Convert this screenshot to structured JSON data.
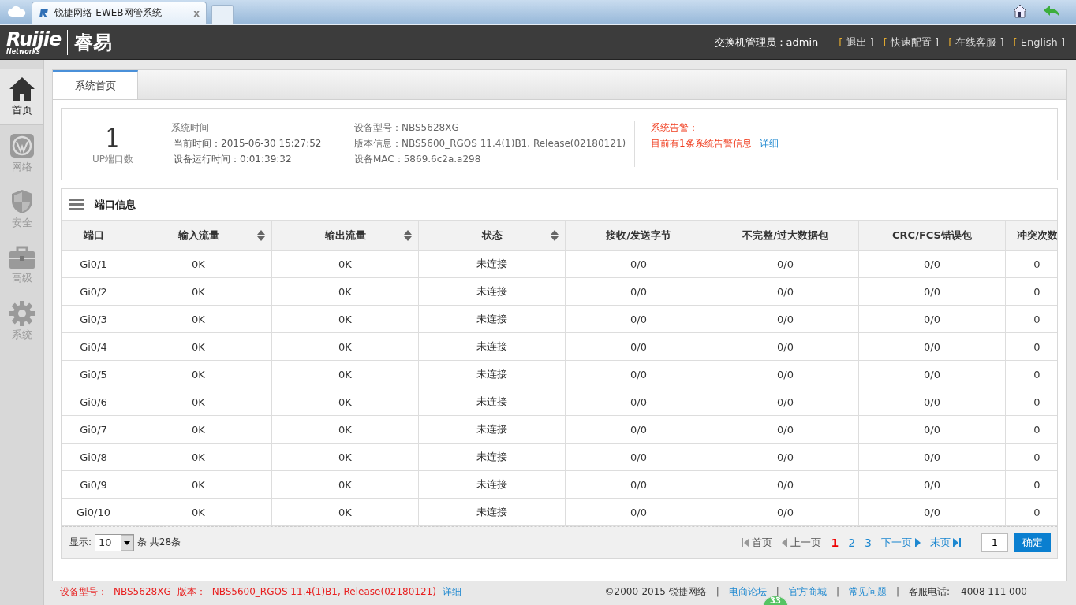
{
  "browser": {
    "tab_title": "锐捷网络-EWEB网管系统",
    "tab_close": "x"
  },
  "header": {
    "logo_text": "Ruijie",
    "logo_sub": "Networks",
    "product": "睿易",
    "admin_label": "交换机管理员：admin",
    "links": [
      {
        "open": "[",
        "label": "退出",
        "close": "]"
      },
      {
        "open": "[",
        "label": "快速配置",
        "close": "]"
      },
      {
        "open": "[",
        "label": "在线客服",
        "close": "]"
      },
      {
        "open": "[",
        "label": "English",
        "close": "]"
      }
    ]
  },
  "sidebar": {
    "items": [
      {
        "label": "首页",
        "kind": "home",
        "selected": true
      },
      {
        "label": "网络",
        "kind": "network",
        "selected": false
      },
      {
        "label": "安全",
        "kind": "security",
        "selected": false
      },
      {
        "label": "高级",
        "kind": "advanced",
        "selected": false
      },
      {
        "label": "系统",
        "kind": "system",
        "selected": false
      }
    ]
  },
  "tabs": [
    {
      "label": "系统首页",
      "selected": true
    }
  ],
  "summary": {
    "up_count": "1",
    "up_label": "UP端口数",
    "time_title": "系统时间",
    "current_time": "当前时间：2015-06-30 15:27:52",
    "uptime": "设备运行时间：0:01:39:32",
    "model": "设备型号：NBS5628XG",
    "version": "版本信息：NBS5600_RGOS 11.4(1)B1, Release(02180121)",
    "mac": "设备MAC：5869.6c2a.a298",
    "alarm_title": "系统告警：",
    "alarm_text": "目前有1条系统告警信息",
    "alarm_link": "详细"
  },
  "port_panel": {
    "title": "端口信息",
    "table": {
      "columns": [
        {
          "label": "端口",
          "sortable": false
        },
        {
          "label": "输入流量",
          "sortable": true
        },
        {
          "label": "输出流量",
          "sortable": true
        },
        {
          "label": "状态",
          "sortable": true
        },
        {
          "label": "接收/发送字节",
          "sortable": false
        },
        {
          "label": "不完整/过大数据包",
          "sortable": false
        },
        {
          "label": "CRC/FCS错误包",
          "sortable": false
        },
        {
          "label": "冲突次数",
          "sortable": false
        }
      ],
      "rows": [
        [
          "Gi0/1",
          "0K",
          "0K",
          "未连接",
          "0/0",
          "0/0",
          "0/0",
          "0"
        ],
        [
          "Gi0/2",
          "0K",
          "0K",
          "未连接",
          "0/0",
          "0/0",
          "0/0",
          "0"
        ],
        [
          "Gi0/3",
          "0K",
          "0K",
          "未连接",
          "0/0",
          "0/0",
          "0/0",
          "0"
        ],
        [
          "Gi0/4",
          "0K",
          "0K",
          "未连接",
          "0/0",
          "0/0",
          "0/0",
          "0"
        ],
        [
          "Gi0/5",
          "0K",
          "0K",
          "未连接",
          "0/0",
          "0/0",
          "0/0",
          "0"
        ],
        [
          "Gi0/6",
          "0K",
          "0K",
          "未连接",
          "0/0",
          "0/0",
          "0/0",
          "0"
        ],
        [
          "Gi0/7",
          "0K",
          "0K",
          "未连接",
          "0/0",
          "0/0",
          "0/0",
          "0"
        ],
        [
          "Gi0/8",
          "0K",
          "0K",
          "未连接",
          "0/0",
          "0/0",
          "0/0",
          "0"
        ],
        [
          "Gi0/9",
          "0K",
          "0K",
          "未连接",
          "0/0",
          "0/0",
          "0/0",
          "0"
        ],
        [
          "Gi0/10",
          "0K",
          "0K",
          "未连接",
          "0/0",
          "0/0",
          "0/0",
          "0"
        ]
      ]
    },
    "pager": {
      "show_label": "显示:",
      "page_size": "10",
      "total": "条 共28条",
      "first": {
        "label": "首页",
        "disabled": true
      },
      "prev": {
        "label": "上一页",
        "disabled": true
      },
      "pages": [
        {
          "label": "1",
          "selected": true
        },
        {
          "label": "2",
          "selected": false
        },
        {
          "label": "3",
          "selected": false
        }
      ],
      "next": {
        "label": "下一页",
        "disabled": false
      },
      "last": {
        "label": "末页",
        "disabled": false
      },
      "goto_value": "1",
      "confirm": "确定"
    }
  },
  "footer": {
    "model_label": "设备型号：",
    "model": "NBS5628XG",
    "version_label": "版本：",
    "version": "NBS5600_RGOS 11.4(1)B1, Release(02180121)",
    "detail": "详细",
    "copyright": "©2000-2015 锐捷网络",
    "links": [
      "电商论坛",
      "官方商城",
      "常见问题"
    ],
    "separators": [
      "|",
      "|",
      "|",
      "|"
    ],
    "phone_label": "客服电话:",
    "phone": "4008 111 000",
    "badge": "33"
  }
}
